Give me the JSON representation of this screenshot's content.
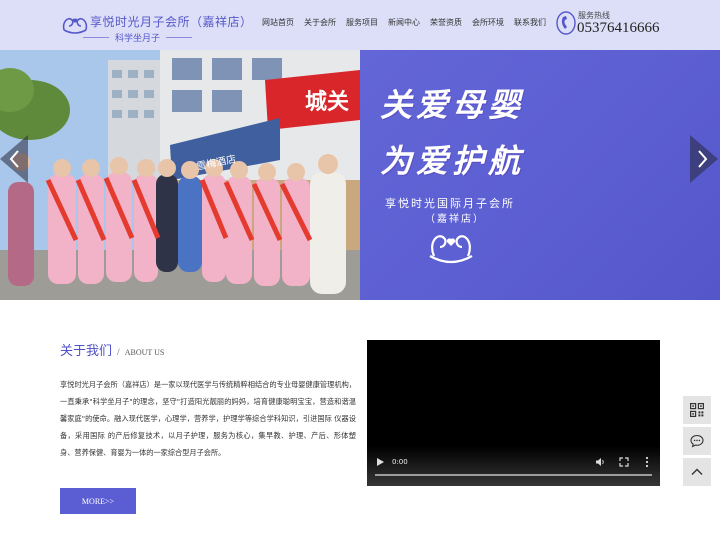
{
  "header": {
    "logo": {
      "title": "享悦时光月子会所（嘉祥店）",
      "subtitle": "科学坐月子"
    },
    "nav": [
      "网站首页",
      "关于会所",
      "服务项目",
      "新闻中心",
      "荣誉资质",
      "会所环境",
      "联系我们"
    ],
    "hotline": {
      "label": "服务热线",
      "number": "05376416666"
    }
  },
  "banner": {
    "slogan_line1": "关爱母婴",
    "slogan_line2": "为爱护航",
    "brand": "享悦时光国际月子会所",
    "branch": "（嘉祥店）",
    "storefront_sign": "城关",
    "hotel_sign": "雪梅酒店"
  },
  "about": {
    "title": "关于我们",
    "separator": "/",
    "title_en": "ABOUT US",
    "description": "享悦时光月子会所（嘉祥店）是一家以现代医学与传统精粹相结合的专业母婴健康管理机构，一直秉承\"科学坐月子\"的理念，坚守\"打造阳光靓丽的妈妈，培育健康聪明宝宝，营造和谐温馨家庭\"的使命。融入现代医学，心理学，营养学，护理学等综合学科知识，引进国际 仪器设备，采用国际 的产后修复技术，以月子护理，服务为核心，集早教、护理、产后、形体塑身、营养保健、育婴为一体的一家综合型月子会所。",
    "more_label": "MORE>>"
  },
  "video": {
    "time": "0:00",
    "progress": 0
  },
  "colors": {
    "brand": "#5b5ed2",
    "header_bg": "#dcdef8",
    "banner_purple": "#6366d6"
  }
}
